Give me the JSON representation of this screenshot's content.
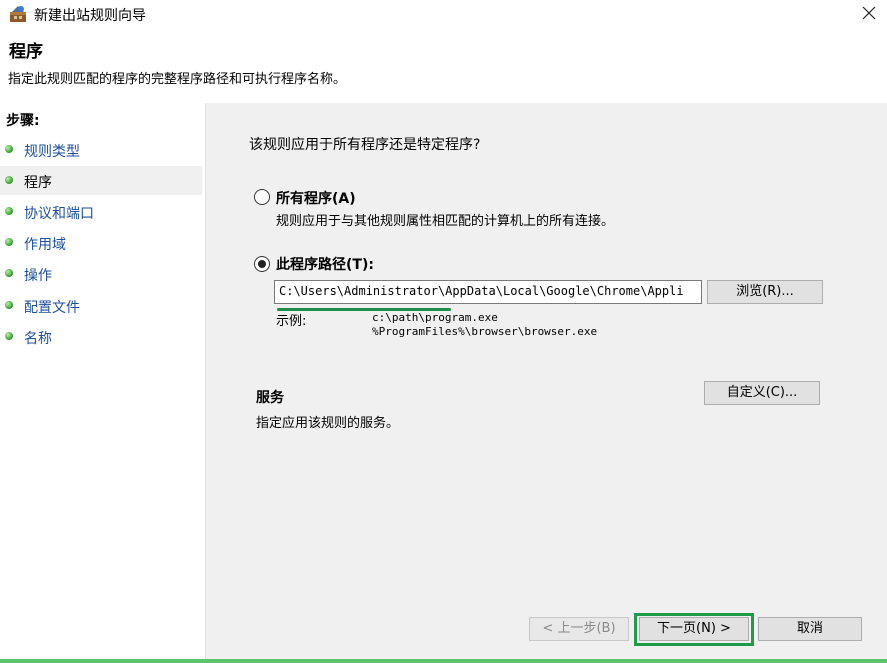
{
  "window": {
    "title": "新建出站规则向导"
  },
  "header": {
    "title": "程序",
    "description": "指定此规则匹配的程序的完整程序路径和可执行程序名称。"
  },
  "steps": {
    "title": "步骤:",
    "items": [
      {
        "label": "规则类型",
        "active": false
      },
      {
        "label": "程序",
        "active": true
      },
      {
        "label": "协议和端口",
        "active": false
      },
      {
        "label": "作用域",
        "active": false
      },
      {
        "label": "操作",
        "active": false
      },
      {
        "label": "配置文件",
        "active": false
      },
      {
        "label": "名称",
        "active": false
      }
    ]
  },
  "main": {
    "question": "该规则应用于所有程序还是特定程序?",
    "options": [
      {
        "label": "所有程序(A)",
        "description": "规则应用于与其他规则属性相匹配的计算机上的所有连接。",
        "checked": false
      },
      {
        "label": "此程序路径(T):",
        "checked": true
      }
    ],
    "path_value": "C:\\Users\\Administrator\\AppData\\Local\\Google\\Chrome\\Appli",
    "browse_label": "浏览(R)...",
    "example_label": "示例:",
    "example_lines": [
      "c:\\path\\program.exe",
      "%ProgramFiles%\\browser\\browser.exe"
    ],
    "service_title": "服务",
    "service_desc": "指定应用该规则的服务。",
    "customize_label": "自定义(C)..."
  },
  "footer": {
    "back_label": "< 上一步(B)",
    "next_label": "下一页(N) >",
    "cancel_label": "取消"
  }
}
